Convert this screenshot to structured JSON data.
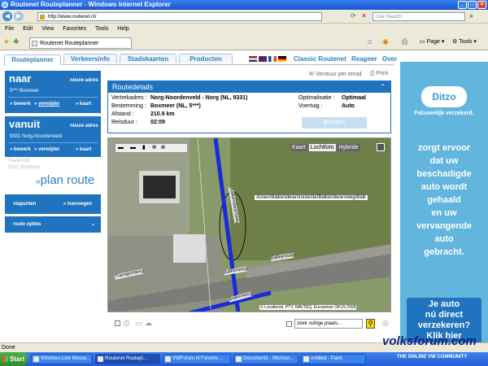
{
  "window": {
    "title": "Routenet Routeplanner - Windows Internet Explorer"
  },
  "address": {
    "url": "http://www.routenet.nl/",
    "search_placeholder": "Live Search"
  },
  "menu": [
    "File",
    "Edit",
    "View",
    "Favorites",
    "Tools",
    "Help"
  ],
  "tab": {
    "title": "Routenet Routeplanner"
  },
  "toolbar": {
    "page_label": "Page",
    "tools_label": "Tools"
  },
  "nav": {
    "tabs": [
      "Routeplanner",
      "Verkeersinfo",
      "Stadskaarten",
      "Producten"
    ],
    "links": [
      "Classic Routenet",
      "Reageer",
      "Over"
    ]
  },
  "sidebar": {
    "naar": {
      "label": "naar",
      "new_address": "nieuw adres",
      "value": "5*** Boxmeer",
      "bewerk": "bewerk",
      "verwijder": "verwijder",
      "kaart": "kaart"
    },
    "vanuit": {
      "label": "vanuit",
      "new_address": "nieuw adres",
      "value": "9331 Norg-Noordenveld",
      "bewerk": "bewerk",
      "verwijder": "verwijder",
      "kaart": "kaart",
      "address_line1": "Havikstrjd",
      "address_line2": "5831 Boxmeer"
    },
    "plan_route": "plan route",
    "viapunten": "viapunten",
    "toevoegen": "toevoegen",
    "route_opties": "route opties"
  },
  "actions": {
    "email": "Verstuur per email",
    "print": "Print"
  },
  "route": {
    "header": "Routedetails",
    "rows": [
      {
        "label": "Vertrekadres :",
        "value": "Norg-Noordenveld - Norg (NL, 9331)"
      },
      {
        "label": "Bestemming :",
        "value": "Boxmeer (NL, 5***)"
      },
      {
        "label": "Afstand :",
        "value": "210.9 km"
      },
      {
        "label": "Reisduur :",
        "value": "02:09"
      }
    ],
    "options": [
      {
        "label": "Optimalisatie :",
        "value": "Optimaal"
      },
      {
        "label": "Voertuig :",
        "value": "Auto"
      }
    ],
    "bereken": "Bereken"
  },
  "map": {
    "modes": [
      "Kaart",
      "Luchtfoto",
      "Hybride"
    ],
    "labels": {
      "street_top": "Assen/Balkendwarsroute/de/Balkendwarsweg/Balk",
      "road1": "Balkenweg",
      "road2": "Balkenweg",
      "road3": "Balkenweg",
      "road4": "Transportweg",
      "road5": "Balkendwarsweg",
      "copyright": "© Locatienet, PTV, NAVTEQ, Eurosense OKLN 2008"
    },
    "search_placeholder": "zoek nuttige plaats..."
  },
  "ad": {
    "brand": "Ditzo",
    "slogan": "Fatsoenlijk verzekerd.",
    "lines": [
      "zorgt ervoor",
      "dat uw",
      "beschadigde",
      "auto wordt",
      "gehaald",
      "en uw",
      "vervangende",
      "auto",
      "gebracht."
    ],
    "cta_lines": [
      "Je auto",
      "nú direct",
      "verzekeren?",
      "Klik hier"
    ]
  },
  "status": {
    "text": "Done"
  },
  "taskbar": {
    "start": "Start",
    "tasks": [
      "Windows Live Messe...",
      "Routenet Routepl...",
      "VWForum.nl Forums-...",
      "Document1 - Microso...",
      "untitled - Paint"
    ]
  },
  "watermark": {
    "main": "volksforum.com",
    "sub": "THE ONLINE VW COMMUNITY"
  },
  "colors": {
    "brand_blue": "#1f73bf",
    "link_blue": "#2d7fc1",
    "ad_blue": "#62b6de",
    "route_line": "#1a2bd8"
  }
}
